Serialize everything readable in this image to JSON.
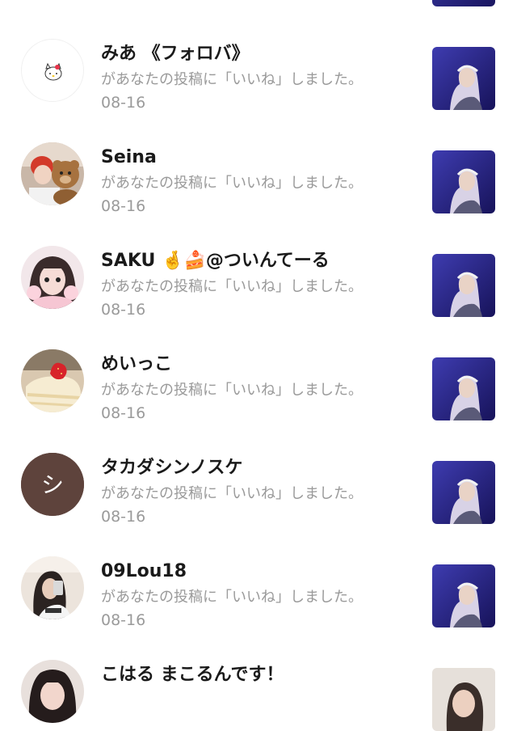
{
  "notifications": [
    {
      "name": "",
      "message": "",
      "date": "08-16",
      "avatar_icon": "partial-avatar",
      "thumb_icon": "performer-photo"
    },
    {
      "name": "みあ 《フォロバ》",
      "message": "があなたの投稿に「いいね」しました。",
      "date": "08-16",
      "avatar_icon": "hello-kitty-avatar",
      "thumb_icon": "performer-photo"
    },
    {
      "name": "Seina",
      "message": "があなたの投稿に「いいね」しました。",
      "date": "08-16",
      "avatar_icon": "person-with-teddy-bear-avatar",
      "thumb_icon": "performer-photo"
    },
    {
      "name": "SAKU 🤞🍰@ついんてーる",
      "message": "があなたの投稿に「いいね」しました。",
      "date": "08-16",
      "avatar_icon": "girl-photo-avatar",
      "thumb_icon": "performer-photo"
    },
    {
      "name": "めいっこ",
      "message": "があなたの投稿に「いいね」しました。",
      "date": "08-16",
      "avatar_icon": "strawberry-cake-avatar",
      "thumb_icon": "performer-photo"
    },
    {
      "name": "タカダシンノスケ",
      "message": "があなたの投稿に「いいね」しました。",
      "date": "08-16",
      "avatar_icon": "initial-avatar",
      "avatar_initial": "シ",
      "avatar_color": "#5e433c",
      "thumb_icon": "performer-photo"
    },
    {
      "name": "09Lou18",
      "message": "があなたの投稿に「いいね」しました。",
      "date": "08-16",
      "avatar_icon": "selfie-photo-avatar",
      "thumb_icon": "performer-photo"
    },
    {
      "name": "こはる まこるんです！",
      "message": "",
      "date": "",
      "avatar_icon": "girl-photo-avatar",
      "thumb_icon": "person-photo"
    }
  ],
  "colors": {
    "name_text": "#1a1a1a",
    "secondary_text": "#9a9a9a",
    "thumb_bg": "#2a2a8c"
  }
}
